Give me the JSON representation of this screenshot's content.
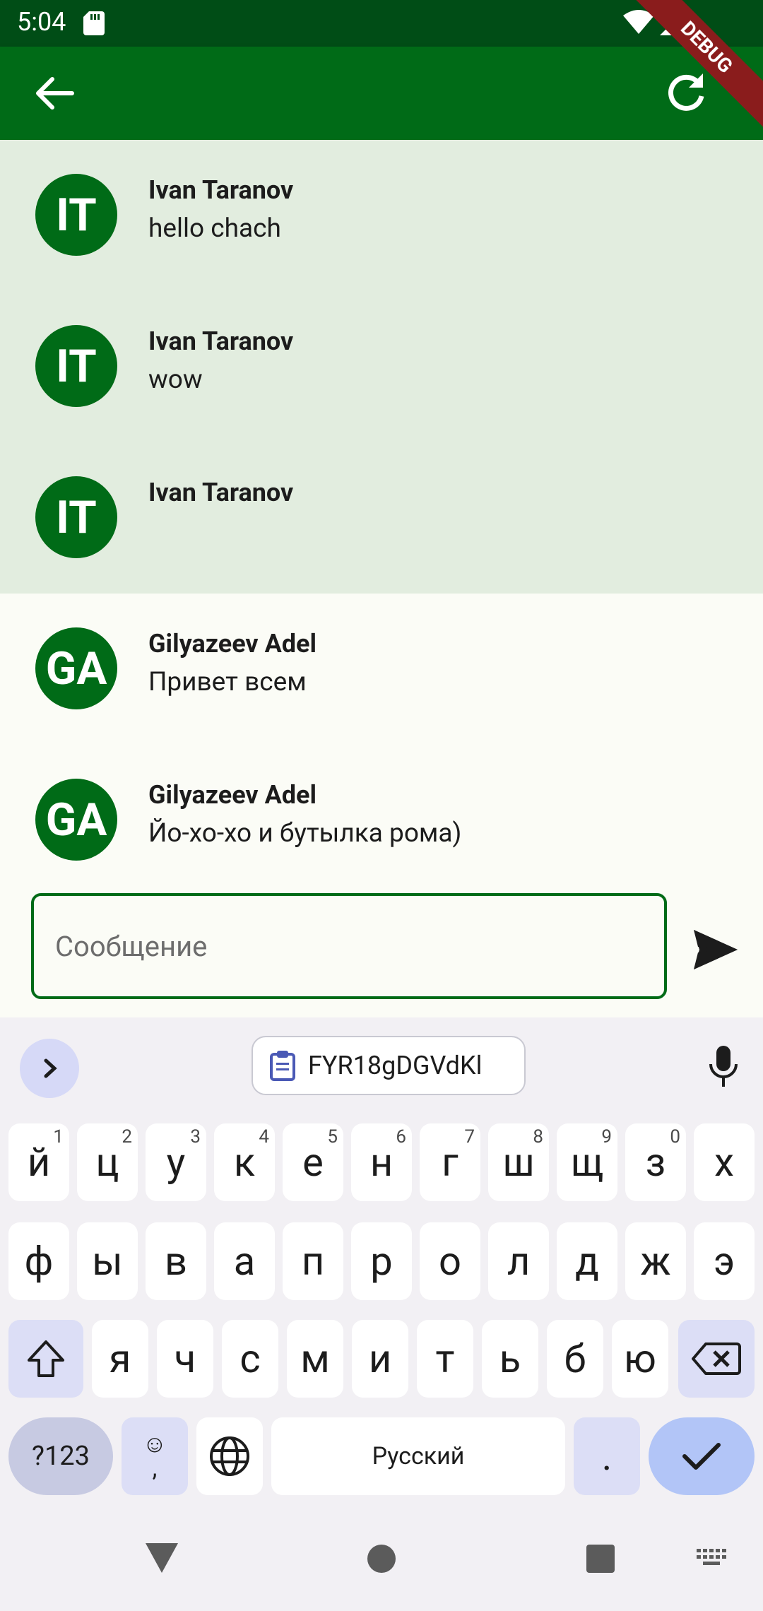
{
  "status_bar": {
    "time": "5:04",
    "debug_label": "DEBUG"
  },
  "app_bar": {
    "back_icon": "arrow-left-icon",
    "refresh_icon": "refresh-icon"
  },
  "messages": [
    {
      "initials": "IT",
      "name": "Ivan Taranov",
      "text": "hello chach",
      "selected": true
    },
    {
      "initials": "IT",
      "name": "Ivan Taranov",
      "text": "wow",
      "selected": true
    },
    {
      "initials": "IT",
      "name": "Ivan Taranov",
      "text": "",
      "selected": true
    },
    {
      "initials": "GA",
      "name": "Gilyazeev Adel",
      "text": "Привет всем",
      "selected": false
    },
    {
      "initials": "GA",
      "name": "Gilyazeev Adel",
      "text": "Йо-хо-хо и бутылка рома)",
      "selected": false
    }
  ],
  "composer": {
    "placeholder": "Сообщение",
    "send_icon": "send-icon"
  },
  "keyboard": {
    "clipboard_text": "FYR18gDGVdKl",
    "row1": [
      {
        "k": "й",
        "s": "1"
      },
      {
        "k": "ц",
        "s": "2"
      },
      {
        "k": "у",
        "s": "3"
      },
      {
        "k": "к",
        "s": "4"
      },
      {
        "k": "е",
        "s": "5"
      },
      {
        "k": "н",
        "s": "6"
      },
      {
        "k": "г",
        "s": "7"
      },
      {
        "k": "ш",
        "s": "8"
      },
      {
        "k": "щ",
        "s": "9"
      },
      {
        "k": "з",
        "s": "0"
      },
      {
        "k": "х",
        "s": ""
      }
    ],
    "row2": [
      "ф",
      "ы",
      "в",
      "а",
      "п",
      "р",
      "о",
      "л",
      "д",
      "ж",
      "э"
    ],
    "row3": [
      "я",
      "ч",
      "с",
      "м",
      "и",
      "т",
      "ь",
      "б",
      "ю"
    ],
    "numbers_label": "?123",
    "emoji_label": "☺",
    "comma_label": ",",
    "space_label": "Русский",
    "period_label": "."
  },
  "colors": {
    "primary": "#006b17",
    "status_bar": "#004d16",
    "selected_row": "#e2eddf"
  }
}
